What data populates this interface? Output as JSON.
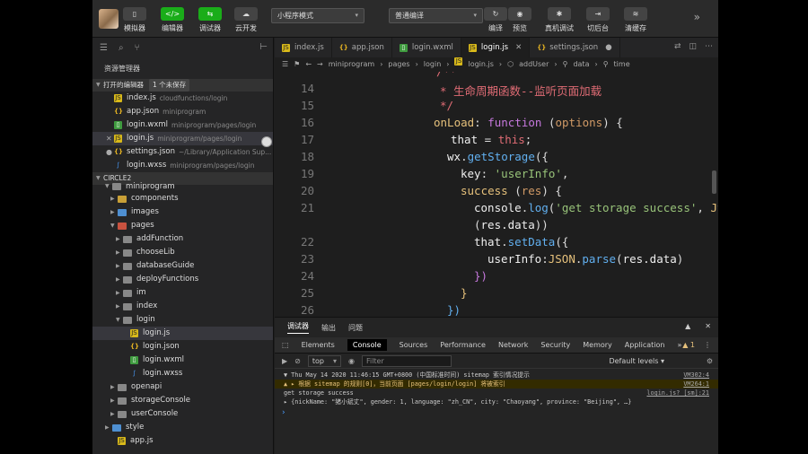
{
  "toolbar": {
    "simulator": "模拟器",
    "editor": "编辑器",
    "debugger": "调试器",
    "cloud": "云开发",
    "mode_select": "小程序模式",
    "compile_select": "普通编译",
    "compile": "编译",
    "preview": "预览",
    "real_debug": "真机调试",
    "background": "切后台",
    "clear_cache": "清缓存"
  },
  "sidebar": {
    "title": "资源管理器",
    "open_editors_label": "打开的编辑器",
    "unsaved_badge": "1 个未保存",
    "open_files": [
      {
        "name": "index.js",
        "path": "cloudfunctions/login"
      },
      {
        "name": "app.json",
        "path": "miniprogram"
      },
      {
        "name": "login.wxml",
        "path": "miniprogram/pages/login"
      },
      {
        "name": "login.js",
        "path": "miniprogram/pages/login"
      },
      {
        "name": "settings.json",
        "path": "~/Library/Application Sup..."
      },
      {
        "name": "login.wxss",
        "path": "miniprogram/pages/login"
      }
    ],
    "project_label": "CIRCLE2",
    "tree": {
      "miniprogram": "miniprogram",
      "components": "components",
      "images": "images",
      "pages": "pages",
      "addFunction": "addFunction",
      "chooseLib": "chooseLib",
      "databaseGuide": "databaseGuide",
      "deployFunctions": "deployFunctions",
      "im": "im",
      "index": "index",
      "login": "login",
      "login_js": "login.js",
      "login_json": "login.json",
      "login_wxml": "login.wxml",
      "login_wxss": "login.wxss",
      "openapi": "openapi",
      "storageConsole": "storageConsole",
      "userConsole": "userConsole",
      "style": "style",
      "app_js": "app.js"
    }
  },
  "tabs": [
    {
      "name": "index.js"
    },
    {
      "name": "app.json"
    },
    {
      "name": "login.wxml"
    },
    {
      "name": "login.js"
    },
    {
      "name": "settings.json"
    }
  ],
  "breadcrumb": [
    "miniprogram",
    "pages",
    "login",
    "login.js",
    "addUser",
    "data",
    "time"
  ],
  "code": {
    "line_numbers": [
      "14",
      "15",
      "16",
      "17",
      "18",
      "19",
      "20",
      "21",
      "",
      "22",
      "23",
      "24",
      "25",
      "26"
    ],
    "comment_line": "* 生命周期函数--监听页面加载",
    "comment_end": "*/",
    "onload_name": "onLoad",
    "onload_rest": "function",
    "onload_param": "options",
    "that_line_a": "that",
    "that_line_b": "this",
    "wx": "wx",
    "getStorage": "getStorage",
    "key": "key",
    "key_value": "'userInfo'",
    "success": "success",
    "res": "res",
    "console": "console",
    "log": "log",
    "log_str": "'get storage success'",
    "JSON": "JSON",
    "parse": "parse",
    "res_data": "res.data",
    "setData": "setData",
    "userInfo": "userInfo"
  },
  "devtools": {
    "tabs_top": [
      "调试器",
      "输出",
      "问题"
    ],
    "panels": [
      "Elements",
      "Console",
      "Sources",
      "Performance",
      "Network",
      "Security",
      "Memory",
      "Application"
    ],
    "warn_count": "1",
    "context": "top",
    "filter_placeholder": "Filter",
    "levels": "Default levels",
    "logs": {
      "l1": "▼ Thu May 14 2020 11:46:15 GMT+0800 (中国标准时间) sitemap 索引情况提示",
      "l1_src": "VM302:4",
      "l2": "▲  ▸ 根据 sitemap 的规则[0]，当前页面 [pages/login/login] 将被索引",
      "l2_src": "VM264:1",
      "l3": "get storage success",
      "l3_src": "login.js? [sm]:21",
      "l4": "▸ {nickName: \"猪小斌丈\", gender: 1, language: \"zh_CN\", city: \"Chaoyang\", province: \"Beijing\", …}"
    }
  }
}
